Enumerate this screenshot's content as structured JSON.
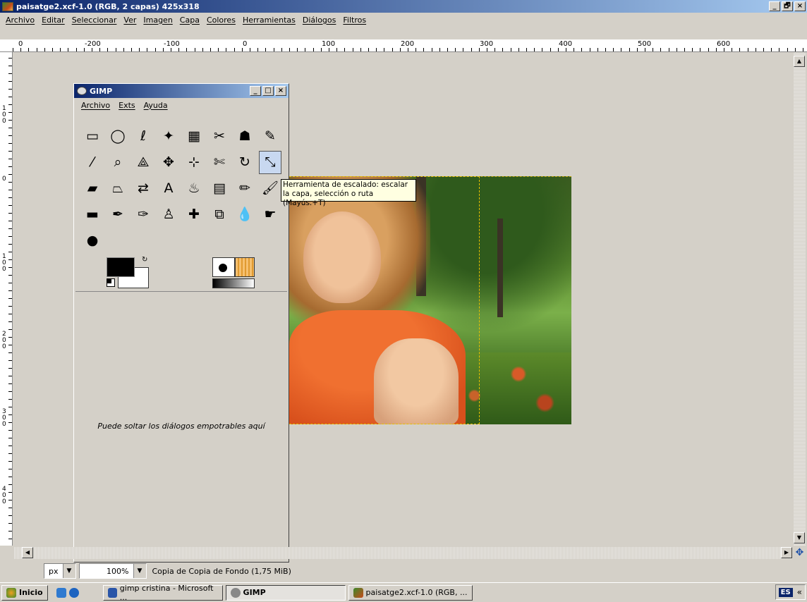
{
  "window": {
    "title": "paisatge2.xcf-1.0 (RGB, 2 capas) 425x318",
    "buttons": [
      "_",
      "🗗",
      "×"
    ]
  },
  "menubar": [
    "Archivo",
    "Editar",
    "Seleccionar",
    "Ver",
    "Imagen",
    "Capa",
    "Colores",
    "Herramientas",
    "Diálogos",
    "Filtros"
  ],
  "ruler_top_labels": [
    "0",
    "-200",
    "-100",
    "0",
    "100",
    "200",
    "300",
    "400",
    "500",
    "600"
  ],
  "ruler_left_labels": [
    "100",
    "0",
    "100",
    "200",
    "300",
    "400"
  ],
  "toolbox": {
    "title": "GIMP",
    "menu": [
      "Archivo",
      "Exts",
      "Ayuda"
    ],
    "tools": [
      {
        "name": "rect-select",
        "glyph": "▭"
      },
      {
        "name": "ellipse-select",
        "glyph": "◯"
      },
      {
        "name": "free-select",
        "glyph": "ℓ"
      },
      {
        "name": "fuzzy-select",
        "glyph": "✦"
      },
      {
        "name": "select-by-color",
        "glyph": "▦"
      },
      {
        "name": "scissors",
        "glyph": "✂"
      },
      {
        "name": "foreground-select",
        "glyph": "☗"
      },
      {
        "name": "paths",
        "glyph": "✎"
      },
      {
        "name": "color-picker",
        "glyph": "⁄"
      },
      {
        "name": "zoom",
        "glyph": "⌕"
      },
      {
        "name": "measure",
        "glyph": "⟁"
      },
      {
        "name": "move",
        "glyph": "✥"
      },
      {
        "name": "align",
        "glyph": "⊹"
      },
      {
        "name": "crop",
        "glyph": "✄"
      },
      {
        "name": "rotate",
        "glyph": "↻"
      },
      {
        "name": "scale",
        "glyph": "⤡"
      },
      {
        "name": "shear",
        "glyph": "▰"
      },
      {
        "name": "perspective",
        "glyph": "⏢"
      },
      {
        "name": "flip",
        "glyph": "⇄"
      },
      {
        "name": "text",
        "glyph": "A"
      },
      {
        "name": "bucket-fill",
        "glyph": "♨"
      },
      {
        "name": "blend",
        "glyph": "▤"
      },
      {
        "name": "pencil",
        "glyph": "✏"
      },
      {
        "name": "paintbrush",
        "glyph": "🖌"
      },
      {
        "name": "eraser",
        "glyph": "▬"
      },
      {
        "name": "airbrush",
        "glyph": "✒"
      },
      {
        "name": "ink",
        "glyph": "✑"
      },
      {
        "name": "clone",
        "glyph": "♙"
      },
      {
        "name": "heal",
        "glyph": "✚"
      },
      {
        "name": "perspective-clone",
        "glyph": "⧉"
      },
      {
        "name": "blur-sharpen",
        "glyph": "💧"
      },
      {
        "name": "smudge",
        "glyph": "☛"
      },
      {
        "name": "dodge-burn",
        "glyph": "●"
      }
    ],
    "active_tool": "scale",
    "dock_hint": "Puede soltar los diálogos empotrables aquí"
  },
  "tooltip": "Herramienta de escalado: escalar la capa, selección o ruta  (Mayús.+T)",
  "statusbar": {
    "unit": "px",
    "zoom": "100%",
    "message": "Copia de Copia de Fondo (1,75 MiB)"
  },
  "taskbar": {
    "start": "Inicio",
    "items": [
      "gimp cristina - Microsoft ...",
      "GIMP",
      "paisatge2.xcf-1.0 (RGB, ..."
    ],
    "language": "ES"
  }
}
